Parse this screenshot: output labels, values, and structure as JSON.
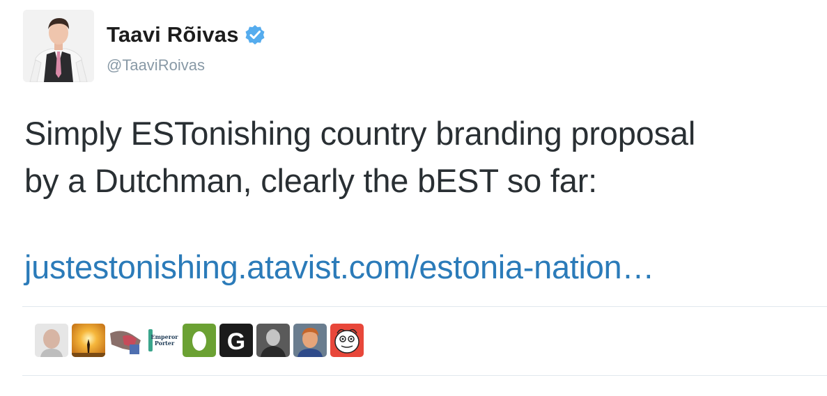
{
  "tweet": {
    "author_name": "Taavi Rõivas",
    "author_handle": "@TaaviRoivas",
    "verified": true,
    "text_lines": [
      "Simply ESTonishing country branding proposal",
      "by a Dutchman, clearly the bEST so far:"
    ],
    "link_text": "justestonishing.atavist.com/estonia-nation…"
  },
  "likers": {
    "avatars": [
      {
        "icon": "person-avatar-bald"
      },
      {
        "icon": "sunset-avatar"
      },
      {
        "icon": "photo-avatar"
      },
      {
        "icon": "emperor-porter-logo",
        "text": "Emperor Porter"
      },
      {
        "icon": "green-egg-avatar"
      },
      {
        "icon": "g-logo-avatar",
        "text": "G"
      },
      {
        "icon": "person-avatar-bw"
      },
      {
        "icon": "person-avatar-redhead"
      },
      {
        "icon": "cartoon-avatar"
      }
    ]
  },
  "colors": {
    "link": "#2b7bb9",
    "handle": "#8899a6",
    "verified_badge": "#55acee",
    "divider": "#e1e8ed"
  }
}
